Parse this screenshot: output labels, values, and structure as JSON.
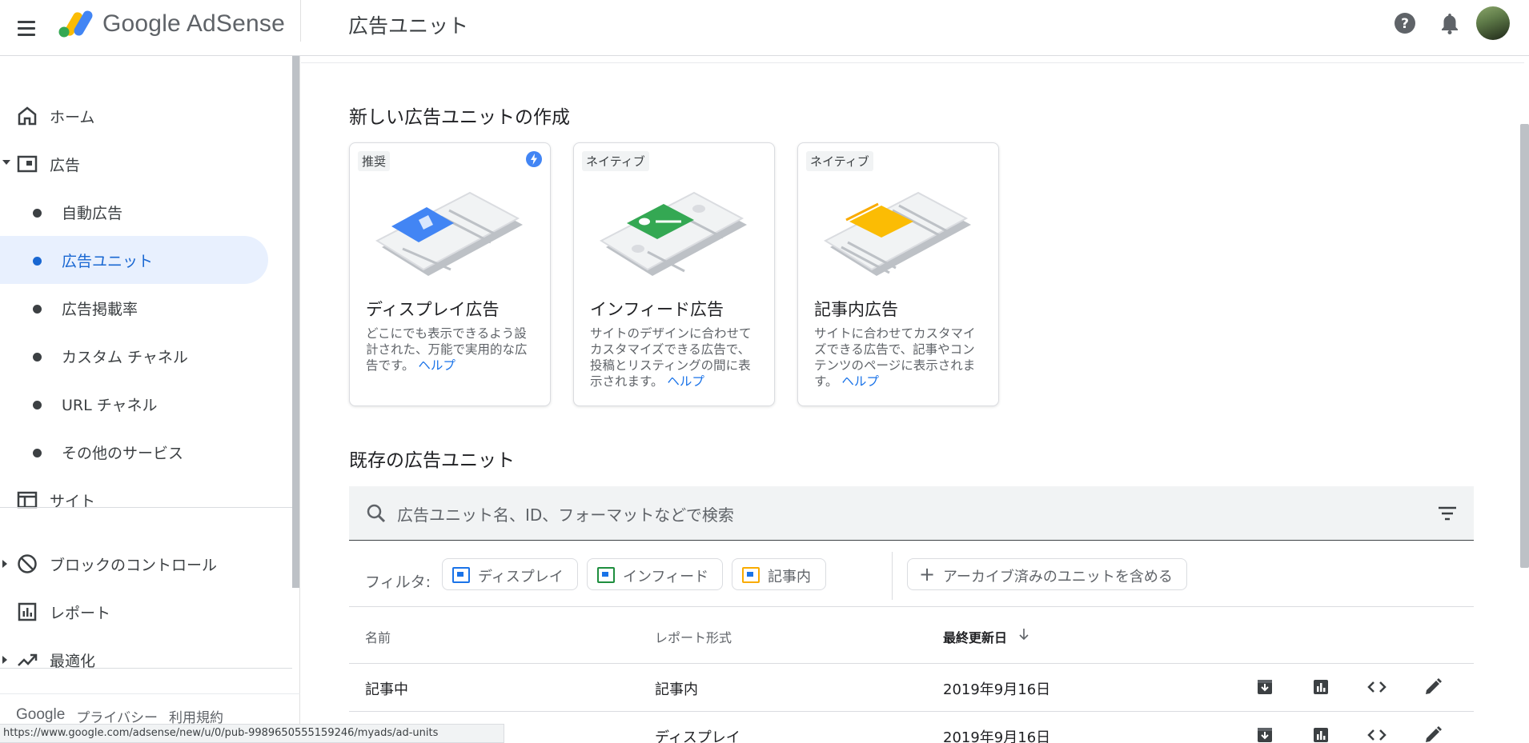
{
  "app": {
    "product_name": "Google AdSense",
    "page_title": "広告ユニット"
  },
  "sidebar": {
    "items": [
      {
        "label": "ホーム",
        "icon": "home-icon"
      },
      {
        "label": "広告",
        "icon": "ad-icon"
      },
      {
        "label": "自動広告"
      },
      {
        "label": "広告ユニット",
        "active": true
      },
      {
        "label": "広告掲載率"
      },
      {
        "label": "カスタム チャネル"
      },
      {
        "label": "URL チャネル"
      },
      {
        "label": "その他のサービス"
      },
      {
        "label": "サイト",
        "icon": "site-icon"
      },
      {
        "label": "ブロックのコントロール",
        "icon": "block-icon"
      },
      {
        "label": "レポート",
        "icon": "report-icon"
      },
      {
        "label": "最適化",
        "icon": "trending-up-icon"
      }
    ],
    "footer": {
      "brand": "Google",
      "privacy": "プライバシー",
      "terms": "利用規約"
    }
  },
  "status_url": "https://www.google.com/adsense/new/u/0/pub-9989650555159246/myads/ad-units",
  "create_section": {
    "title": "新しい広告ユニットの作成",
    "cards": [
      {
        "chip": "推奨",
        "title": "ディスプレイ広告",
        "desc": "どこにでも表示できるよう設計された、万能で実用的な広告です。",
        "help": "ヘルプ",
        "color": "#4285f4"
      },
      {
        "chip": "ネイティブ",
        "title": "インフィード広告",
        "desc": "サイトのデザインに合わせてカスタマイズできる広告で、投稿とリスティングの間に表示されます。",
        "help": "ヘルプ",
        "color": "#34a853"
      },
      {
        "chip": "ネイティブ",
        "title": "記事内広告",
        "desc": "サイトに合わせてカスタマイズできる広告で、記事やコンテンツのページに表示されます。",
        "help": "ヘルプ",
        "color": "#fbbc04"
      }
    ]
  },
  "existing_section": {
    "title": "既存の広告ユニット",
    "search_placeholder": "広告ユニット名、ID、フォーマットなどで検索",
    "filter_label": "フィルタ:",
    "filters": [
      {
        "label": "ディスプレイ",
        "color": "#1a73e8"
      },
      {
        "label": "インフィード",
        "color": "#1e8e3e"
      },
      {
        "label": "記事内",
        "color": "#f9ab00"
      }
    ],
    "archive_toggle": "アーカイブ済みのユニットを含める",
    "columns": [
      "名前",
      "レポート形式",
      "最終更新日"
    ],
    "rows": [
      {
        "name": "記事中",
        "format": "記事内",
        "updated": "2019年9月16日"
      },
      {
        "name": "",
        "format": "ディスプレイ",
        "updated": "2019年9月16日"
      }
    ]
  }
}
